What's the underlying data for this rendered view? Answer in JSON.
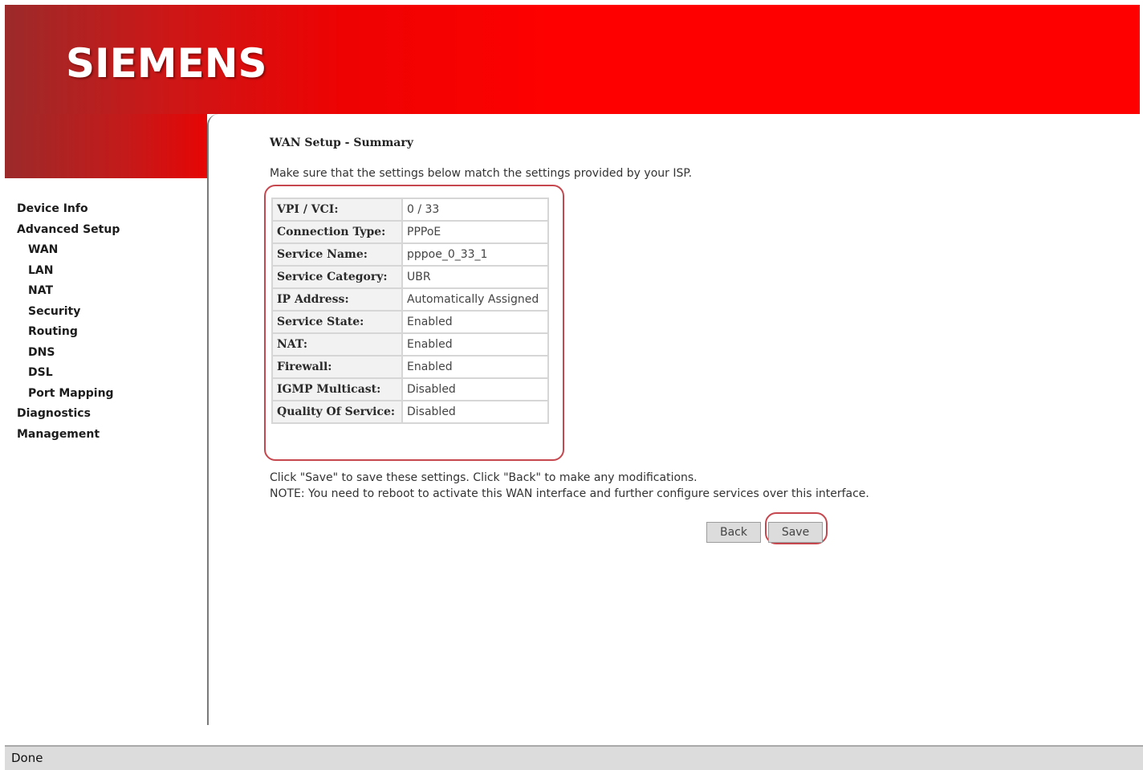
{
  "header": {
    "brand": "SIEMENS"
  },
  "sidebar": {
    "items": [
      {
        "id": "device-info",
        "label": "Device Info"
      },
      {
        "id": "advanced-setup",
        "label": "Advanced Setup"
      },
      {
        "id": "wan",
        "label": "WAN"
      },
      {
        "id": "lan",
        "label": "LAN"
      },
      {
        "id": "nat",
        "label": "NAT"
      },
      {
        "id": "security",
        "label": "Security"
      },
      {
        "id": "routing",
        "label": "Routing"
      },
      {
        "id": "dns",
        "label": "DNS"
      },
      {
        "id": "dsl",
        "label": "DSL"
      },
      {
        "id": "port-mapping",
        "label": "Port Mapping"
      },
      {
        "id": "diagnostics",
        "label": "Diagnostics"
      },
      {
        "id": "management",
        "label": "Management"
      }
    ]
  },
  "main": {
    "title": "WAN Setup - Summary",
    "intro": "Make sure that the settings below match the settings provided by your ISP.",
    "rows": [
      {
        "label": "VPI / VCI:",
        "value": "0 / 33"
      },
      {
        "label": "Connection Type:",
        "value": "PPPoE"
      },
      {
        "label": "Service Name:",
        "value": "pppoe_0_33_1"
      },
      {
        "label": "Service Category:",
        "value": "UBR"
      },
      {
        "label": "IP Address:",
        "value": "Automatically Assigned"
      },
      {
        "label": "Service State:",
        "value": "Enabled"
      },
      {
        "label": "NAT:",
        "value": "Enabled"
      },
      {
        "label": "Firewall:",
        "value": "Enabled"
      },
      {
        "label": "IGMP Multicast:",
        "value": "Disabled"
      },
      {
        "label": "Quality Of Service:",
        "value": "Disabled"
      }
    ],
    "instruction": "Click \"Save\" to save these settings. Click \"Back\" to make any modifications.",
    "note": "NOTE: You need to reboot to activate this WAN interface and further configure services over this interface.",
    "back_label": "Back",
    "save_label": "Save"
  },
  "status": {
    "text": "Done"
  },
  "colors": {
    "brand_red": "#ff0000",
    "highlight": "#c7474f"
  }
}
